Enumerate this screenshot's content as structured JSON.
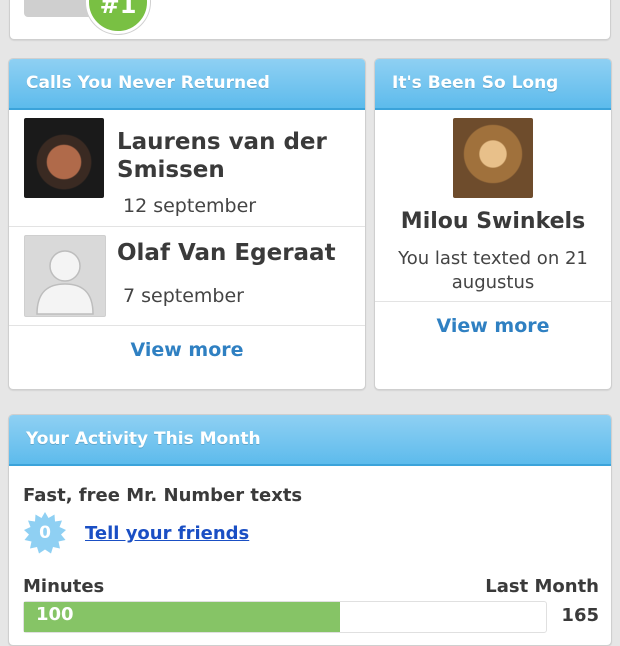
{
  "top": {
    "rank_badge": "#1"
  },
  "calls_card": {
    "title": "Calls You Never Returned",
    "items": [
      {
        "name": "Laurens van der Smissen",
        "date": "12 september"
      },
      {
        "name": "Olaf Van Egeraat",
        "date": "7 september"
      }
    ],
    "view_more": "View more"
  },
  "long_card": {
    "title": "It's Been So Long",
    "name": "Milou Swinkels",
    "last_text": "You last texted on 21 augustus",
    "view_more": "View more"
  },
  "activity": {
    "title": "Your Activity This Month",
    "texts_label": "Fast, free Mr. Number texts",
    "texts_count": "0",
    "tell_friends": "Tell your friends",
    "minutes_label": "Minutes",
    "last_month_label": "Last Month",
    "minutes_value": "100",
    "last_month_value": "165",
    "minutes_fraction": 0.606
  },
  "colors": {
    "accent": "#5dbbec",
    "link": "#2f80c2",
    "progress": "#86c466",
    "badge": "#79c043"
  },
  "icons": {
    "default_avatar": "person-silhouette-icon",
    "count_badge": "starburst-badge-icon"
  }
}
